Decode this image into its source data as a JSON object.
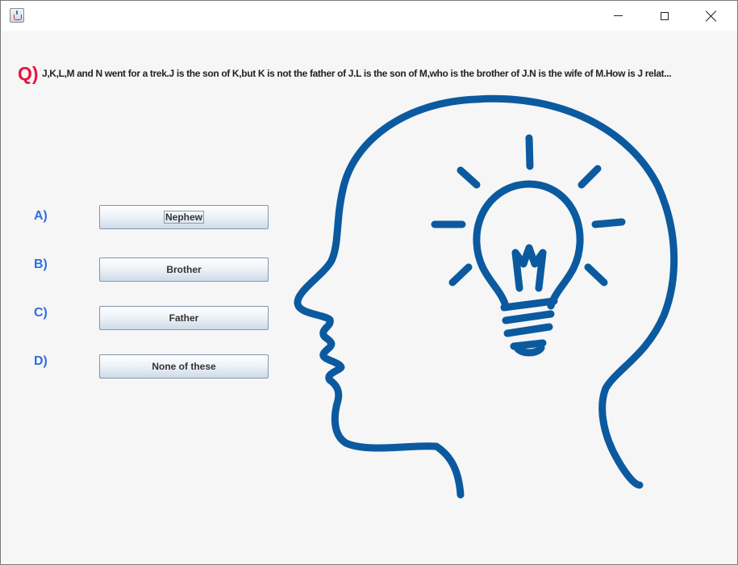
{
  "window": {
    "title": "",
    "controls": {
      "minimize": "minimize",
      "maximize": "maximize",
      "close": "close"
    }
  },
  "question": {
    "marker": "Q)",
    "text": "J,K,L,M and N went for a trek.J is the son of K,but K is not the father of J.L is the son of M,who is the brother of J.N is the wife of M.How is J relat..."
  },
  "options": [
    {
      "letter": "A)",
      "label": "Nephew",
      "focused": true
    },
    {
      "letter": "B)",
      "label": "Brother",
      "focused": false
    },
    {
      "letter": "C)",
      "label": "Father",
      "focused": false
    },
    {
      "letter": "D)",
      "label": "None of these",
      "focused": false
    }
  ],
  "colors": {
    "question_marker": "#e8143c",
    "option_letters": "#2e6fe0",
    "illustration": "#0b5aa0"
  },
  "illustration": {
    "icon": "head-with-lightbulb-icon"
  }
}
